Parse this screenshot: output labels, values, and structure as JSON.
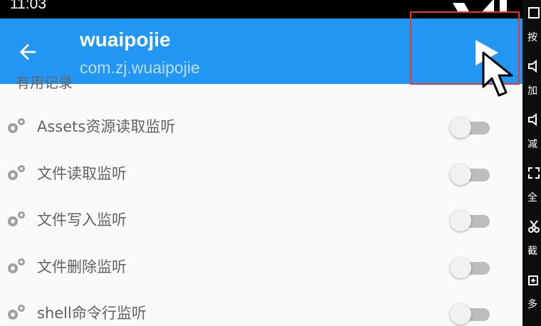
{
  "status_bar": {
    "time": "11:03"
  },
  "app_bar": {
    "back_icon": "arrow-left-icon",
    "title": "wuaipojie",
    "subtitle": "com.zj.wuaipojie",
    "play_icon": "play-icon"
  },
  "partial_header": "有⽤记录",
  "settings": [
    {
      "label": "Assets资源读取监听",
      "enabled": false
    },
    {
      "label": "文件读取监听",
      "enabled": false
    },
    {
      "label": "文件写入监听",
      "enabled": false
    },
    {
      "label": "文件删除监听",
      "enabled": false
    },
    {
      "label": "shell命令行监听",
      "enabled": false
    }
  ],
  "side_toolbar": [
    {
      "icon": "screenshot-icon",
      "label": "按"
    },
    {
      "icon": "volume-up-icon",
      "label": "加"
    },
    {
      "icon": "volume-down-icon",
      "label": "减"
    },
    {
      "icon": "fullscreen-icon",
      "label": "全"
    },
    {
      "icon": "scissors-icon",
      "label": "截"
    },
    {
      "icon": "multi-window-icon",
      "label": "多"
    }
  ],
  "colors": {
    "app_bar": "#2196f3",
    "highlight": "#e53935",
    "toggle_off": "#bdbdbd"
  }
}
